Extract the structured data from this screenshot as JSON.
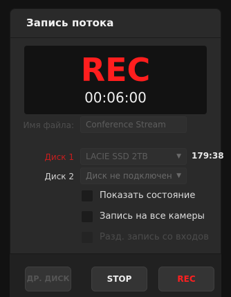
{
  "panel": {
    "title": "Запись потока"
  },
  "display": {
    "rec_label": "REC",
    "timecode": "00:06:00"
  },
  "form": {
    "filename_label": "Имя файла:",
    "filename_value": "Conference Stream",
    "disk1_label": "Диск 1",
    "disk1_value": "LACIE SSD 2TB",
    "disk1_capacity": "179:38",
    "disk2_label": "Диск 2",
    "disk2_value": "Диск не подключен",
    "checkboxes": [
      {
        "label": "Показать состояние",
        "checked": false,
        "enabled": true
      },
      {
        "label": "Запись на все камеры",
        "checked": false,
        "enabled": true
      },
      {
        "label": "Разд. запись со входов",
        "checked": false,
        "enabled": false
      }
    ]
  },
  "buttons": {
    "other_disk": "ДР. ДИСК",
    "stop": "STOP",
    "rec": "REC"
  },
  "colors": {
    "accent_red": "#ff1e1e",
    "panel_bg": "#2a2a2a"
  },
  "icons": {
    "dropdown": "chevron-down-icon"
  }
}
